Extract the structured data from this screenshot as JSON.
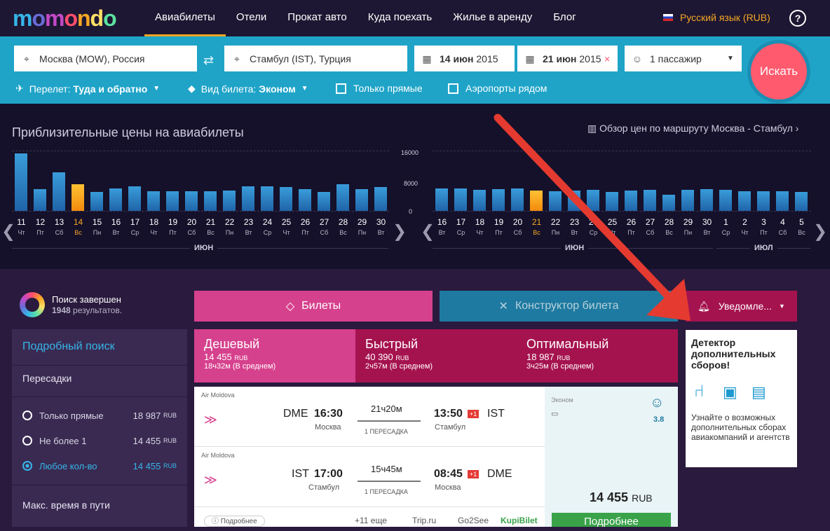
{
  "nav": {
    "logo": "momondo",
    "items": [
      "Авиабилеты",
      "Отели",
      "Прокат авто",
      "Куда поехать",
      "Жилье в аренду",
      "Блог"
    ],
    "language": "Русский язык (RUB)",
    "help_icon": "?"
  },
  "search": {
    "from": "Москва (MOW), Россия",
    "to": "Стамбул (IST), Турция",
    "depart_day": "14 июн",
    "depart_year": "2015",
    "return_day": "21 июн",
    "return_year": "2015",
    "passengers": "1 пассажир",
    "button": "Искать",
    "trip_label": "Перелет:",
    "trip_value": "Туда и обратно",
    "class_label": "Вид билета:",
    "class_value": "Эконом",
    "direct_only": "Только прямые",
    "nearby": "Аэропорты рядом"
  },
  "prices": {
    "title": "Приблизительные цены на авиабилеты",
    "route_link": "Обзор цен по маршруту Москва - Стамбул",
    "yticks": [
      "16000",
      "8000",
      "0"
    ],
    "left": {
      "days": [
        "11",
        "12",
        "13",
        "14",
        "15",
        "16",
        "17",
        "18",
        "19",
        "20",
        "21",
        "22",
        "23",
        "24",
        "25",
        "26",
        "27",
        "28",
        "29",
        "30"
      ],
      "weekdays": [
        "Чт",
        "Пт",
        "Сб",
        "Вс",
        "Пн",
        "Вт",
        "Ср",
        "Чт",
        "Пт",
        "Сб",
        "Вс",
        "Пн",
        "Вт",
        "Ср",
        "Чт",
        "Пт",
        "Сб",
        "Вс",
        "Пн",
        "Вт"
      ],
      "values": [
        15200,
        5800,
        10200,
        7000,
        5000,
        5900,
        6500,
        5300,
        5200,
        5300,
        5200,
        5400,
        6600,
        6500,
        6300,
        5700,
        5000,
        7000,
        5800,
        6400
      ],
      "month": "ИЮН",
      "selected": 3
    },
    "right": {
      "days": [
        "16",
        "17",
        "18",
        "19",
        "20",
        "21",
        "22",
        "23",
        "24",
        "25",
        "26",
        "27",
        "28",
        "29",
        "30",
        "1",
        "2",
        "3",
        "4",
        "5"
      ],
      "weekdays": [
        "Вт",
        "Ср",
        "Чт",
        "Пт",
        "Сб",
        "Вс",
        "Пн",
        "Вт",
        "Ср",
        "Чт",
        "Пт",
        "Сб",
        "Вс",
        "Пн",
        "Вт",
        "Ср",
        "Чт",
        "Пт",
        "Сб",
        "Вс"
      ],
      "values": [
        5900,
        5900,
        5600,
        5700,
        5900,
        5400,
        5300,
        5400,
        5600,
        5000,
        5400,
        5500,
        4200,
        5500,
        5700,
        5600,
        5300,
        5300,
        5200,
        5000
      ],
      "month1": "ИЮН",
      "month2": "ИЮЛ",
      "selected": 5
    }
  },
  "status": {
    "title": "Поиск завершен",
    "count": "1948",
    "count_label": "результатов."
  },
  "sidebar": {
    "header": "Подробный поиск",
    "section": "Пересадки",
    "options": [
      {
        "label": "Только прямые",
        "price": "18 987",
        "cur": "RUB"
      },
      {
        "label": "Не более 1",
        "price": "14 455",
        "cur": "RUB"
      },
      {
        "label": "Любое кол-во",
        "price": "14 455",
        "cur": "RUB"
      }
    ],
    "section2": "Макс. время в пути"
  },
  "tabs": {
    "tickets": "Билеты",
    "builder": "Конструктор билета",
    "alerts": "Уведомле..."
  },
  "sort": [
    {
      "name": "Дешевый",
      "price": "14 455",
      "cur": "RUB",
      "avg": "18ч32м (В среднем)"
    },
    {
      "name": "Быстрый",
      "price": "40 390",
      "cur": "RUB",
      "avg": "2ч57м (В среднем)"
    },
    {
      "name": "Оптимальный",
      "price": "18 987",
      "cur": "RUB",
      "avg": "3ч25м (В среднем)"
    }
  ],
  "flights": [
    {
      "airline": "Air Moldova",
      "from": "DME",
      "dep": "16:30",
      "from_city": "Москва",
      "dur": "21ч20м",
      "stops": "1 ПЕРЕСАДКА",
      "arr": "13:50",
      "plus": "+1",
      "to": "IST",
      "to_city": "Стамбул"
    },
    {
      "airline": "Air Moldova",
      "from": "IST",
      "dep": "17:00",
      "from_city": "Стамбул",
      "dur": "15ч45м",
      "stops": "1 ПЕРЕСАДКА",
      "arr": "08:45",
      "plus": "+1",
      "to": "DME",
      "to_city": "Москва"
    }
  ],
  "fare": {
    "class": "Эконом",
    "rating": "3.8",
    "price": "14 455",
    "cur": "RUB",
    "details_btn": "Подробнее",
    "more_btn": "Подробнее",
    "more": "+11 еще",
    "agents": [
      "Trip.ru",
      "Go2See",
      "KupiBilet"
    ]
  },
  "detector": {
    "title": "Детектор дополнительных сборов!",
    "text": "Узнайте о возможных дополнительных сборах авиакомпаний и агентств"
  }
}
